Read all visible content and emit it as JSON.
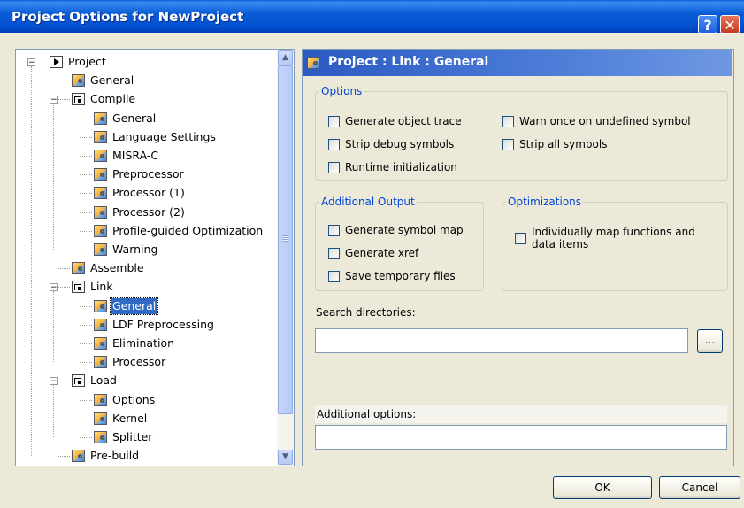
{
  "window": {
    "title": "Project Options for NewProject",
    "help_glyph": "?",
    "close_glyph": "✕"
  },
  "tree": {
    "items": [
      {
        "label": "Project",
        "icon": "project-icon"
      },
      {
        "label": "General",
        "icon": "page-icon"
      },
      {
        "label": "Compile",
        "icon": "folder-icon"
      },
      {
        "label": "General",
        "icon": "page-icon"
      },
      {
        "label": "Language Settings",
        "icon": "page-icon"
      },
      {
        "label": "MISRA-C",
        "icon": "page-icon"
      },
      {
        "label": "Preprocessor",
        "icon": "page-icon"
      },
      {
        "label": "Processor (1)",
        "icon": "page-icon"
      },
      {
        "label": "Processor (2)",
        "icon": "page-icon"
      },
      {
        "label": "Profile-guided Optimization",
        "icon": "page-icon"
      },
      {
        "label": "Warning",
        "icon": "page-icon"
      },
      {
        "label": "Assemble",
        "icon": "page-icon"
      },
      {
        "label": "Link",
        "icon": "folder-icon"
      },
      {
        "label": "General",
        "icon": "page-icon",
        "selected": true
      },
      {
        "label": "LDF Preprocessing",
        "icon": "page-icon"
      },
      {
        "label": "Elimination",
        "icon": "page-icon"
      },
      {
        "label": "Processor",
        "icon": "page-icon"
      },
      {
        "label": "Load",
        "icon": "folder-icon"
      },
      {
        "label": "Options",
        "icon": "page-icon"
      },
      {
        "label": "Kernel",
        "icon": "page-icon"
      },
      {
        "label": "Splitter",
        "icon": "page-icon"
      },
      {
        "label": "Pre-build",
        "icon": "page-icon"
      }
    ],
    "expander_glyph": "−",
    "scroll_up_glyph": "▲",
    "scroll_down_glyph": "▼"
  },
  "panel": {
    "header": "Project : Link : General",
    "options": {
      "legend": "Options",
      "generate_object_trace": "Generate object trace",
      "warn_once": "Warn once on undefined symbol",
      "strip_debug": "Strip debug symbols",
      "strip_all": "Strip all symbols",
      "runtime_init": "Runtime initialization"
    },
    "additional_output": {
      "legend": "Additional Output",
      "symbol_map": "Generate symbol map",
      "xref": "Generate xref",
      "save_temp": "Save temporary files"
    },
    "optimizations": {
      "legend": "Optimizations",
      "individually_map": "Individually map functions and data items"
    },
    "search_directories": {
      "label": "Search directories:",
      "value": "",
      "browse": "..."
    },
    "additional_options": {
      "label": "Additional options:",
      "value": ""
    }
  },
  "buttons": {
    "ok": "OK",
    "cancel": "Cancel"
  }
}
